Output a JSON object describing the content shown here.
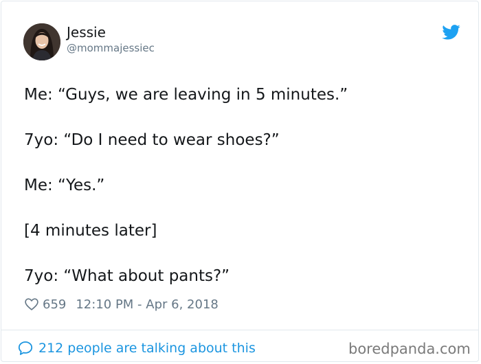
{
  "author": {
    "name": "Jessie",
    "handle": "@mommajessiec"
  },
  "tweet": {
    "lines": [
      "Me: “Guys, we are leaving in 5 minutes.”",
      "7yo: “Do I need to wear shoes?”",
      "Me: “Yes.”",
      "[4 minutes later]",
      "7yo: “What about pants?”"
    ]
  },
  "meta": {
    "likes": "659",
    "timestamp": "12:10 PM - Apr 6, 2018"
  },
  "footer": {
    "talking": "212 people are talking about this"
  },
  "watermark": "boredpanda.com",
  "colors": {
    "twitter_blue": "#1da1f2",
    "link_blue": "#1b95e0",
    "secondary_text": "#657786"
  },
  "icons": {
    "brand": "twitter-bird-icon",
    "like": "heart-icon",
    "reply": "speech-bubble-icon"
  }
}
